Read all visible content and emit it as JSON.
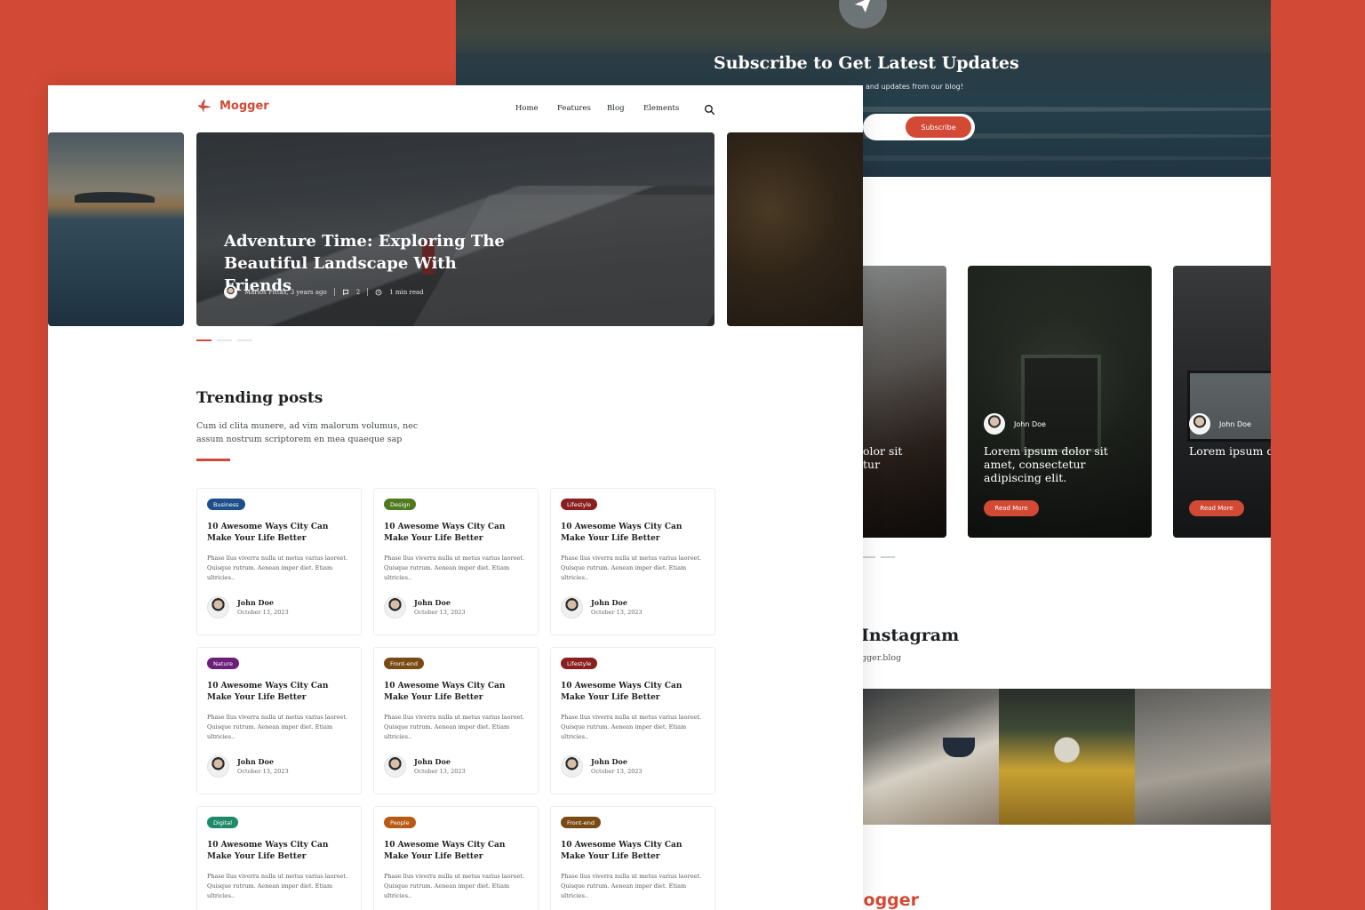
{
  "subscribe": {
    "title": "Subscribe to Get Latest Updates",
    "text": "and updates from our blog!",
    "button": "Subscribe"
  },
  "back_cards": [
    {
      "author": "",
      "title": "olor sit\ntur",
      "read_more": ""
    },
    {
      "author": "John Doe",
      "title": "Lorem ipsum dolor sit amet, consectetur adipiscing elit.",
      "read_more": "Read More"
    },
    {
      "author": "John Doe",
      "title": "Lorem ipsum d amet, consecte adipiscing elit.",
      "read_more": "Read More"
    }
  ],
  "instagram": {
    "title": "Instagram",
    "handle": "gger.blog"
  },
  "footer_logo": "logger",
  "nav": {
    "logo": "Mogger",
    "menu": [
      "Home",
      "Features",
      "Blog",
      "Elements"
    ],
    "search_icon": "search-icon"
  },
  "hero": {
    "title": "Adventure Time: Exploring The Beautiful Landscape With Friends",
    "author": "Marios Pittas, 3 years ago",
    "comments": "2",
    "read_time": "1 min read"
  },
  "trending": {
    "title": "Trending posts",
    "description": "Cum id clita munere, ad vim malorum volumus, nec assum nostrum scriptorem en mea quaeque sap"
  },
  "posts": [
    {
      "category": "Business",
      "color": "#1f4f8a",
      "title": "10 Awesome Ways City Can Make Your Life Better",
      "excerpt": "Phase llus viverra nulla ut metus varius laoreet. Quisque rutrum. Aenean imper diet. Etiam ultricies..",
      "author": "John Doe",
      "date": "October 13, 2023"
    },
    {
      "category": "Design",
      "color": "#4f7a1f",
      "title": "10 Awesome Ways City Can Make Your Life Better",
      "excerpt": "Phase llus viverra nulla ut metus varius laoreet. Quisque rutrum. Aenean imper diet. Etiam ultricies..",
      "author": "John Doe",
      "date": "October 13, 2023"
    },
    {
      "category": "Lifestyle",
      "color": "#8a1f1f",
      "title": "10 Awesome Ways City Can Make Your Life Better",
      "excerpt": "Phase llus viverra nulla ut metus varius laoreet. Quisque rutrum. Aenean imper diet. Etiam ultricies..",
      "author": "John Doe",
      "date": "October 13, 2023"
    },
    {
      "category": "Nature",
      "color": "#6a1f7a",
      "title": "10 Awesome Ways City Can Make Your Life Better",
      "excerpt": "Phase llus viverra nulla ut metus varius laoreet. Quisque rutrum. Aenean imper diet. Etiam ultricies..",
      "author": "John Doe",
      "date": "October 13, 2023"
    },
    {
      "category": "Front-end",
      "color": "#7a4a14",
      "title": "10 Awesome Ways City Can Make Your Life Better",
      "excerpt": "Phase llus viverra nulla ut metus varius laoreet. Quisque rutrum. Aenean imper diet. Etiam ultricies..",
      "author": "John Doe",
      "date": "October 13, 2023"
    },
    {
      "category": "Lifestyle",
      "color": "#8a1f1f",
      "title": "10 Awesome Ways City Can Make Your Life Better",
      "excerpt": "Phase llus viverra nulla ut metus varius laoreet. Quisque rutrum. Aenean imper diet. Etiam ultricies..",
      "author": "John Doe",
      "date": "October 13, 2023"
    },
    {
      "category": "Digital",
      "color": "#1f8a6a",
      "title": "10 Awesome Ways City Can Make Your Life Better",
      "excerpt": "Phase llus viverra nulla ut metus varius laoreet. Quisque rutrum. Aenean imper diet. Etiam ultricies..",
      "author": "",
      "date": ""
    },
    {
      "category": "People",
      "color": "#b85a14",
      "title": "10 Awesome Ways City Can Make Your Life Better",
      "excerpt": "Phase llus viverra nulla ut metus varius laoreet. Quisque rutrum. Aenean imper diet. Etiam ultricies..",
      "author": "",
      "date": ""
    },
    {
      "category": "Front-end",
      "color": "#7a4a14",
      "title": "10 Awesome Ways City Can Make Your Life Better",
      "excerpt": "Phase llus viverra nulla ut metus varius laoreet. Quisque rutrum. Aenean imper diet. Etiam ultricies..",
      "author": "",
      "date": ""
    }
  ],
  "brand_color": "#d24a35"
}
